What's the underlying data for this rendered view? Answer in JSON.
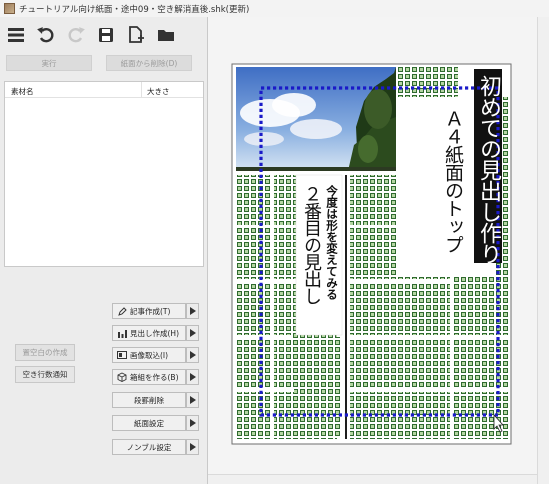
{
  "window": {
    "title": "チュートリアル向け紙面・途中09・空き解消直後.shk(更新)"
  },
  "toolbar": {
    "icons": [
      "menu-icon",
      "undo-icon",
      "redo-icon",
      "save-icon",
      "new-document-icon",
      "open-folder-icon"
    ]
  },
  "actions": {
    "execute": "実行",
    "remove_from_page": "紙面から削除(D)"
  },
  "material_list": {
    "col_name": "素材名",
    "col_size": "大きさ"
  },
  "side_buttons": {
    "reset_blank": "置空白の作成",
    "blank_lines_notice": "空き行数通知"
  },
  "commands": {
    "create_article": "記事作成(T)",
    "create_heading": "見出し作成(H)",
    "import_image": "画像取込(I)",
    "create_box": "箱組を作る(B)",
    "paragraph_delete": "段罫削除",
    "page_settings": "紙面設定",
    "nombre_settings": "ノンブル設定"
  },
  "page": {
    "headline_main": "初めての見出し作り",
    "headline_sub": "Ａ４紙面のトップ",
    "second_headline_top": "今度は形を変えてみる",
    "second_headline_main": "２番目の見出し"
  }
}
